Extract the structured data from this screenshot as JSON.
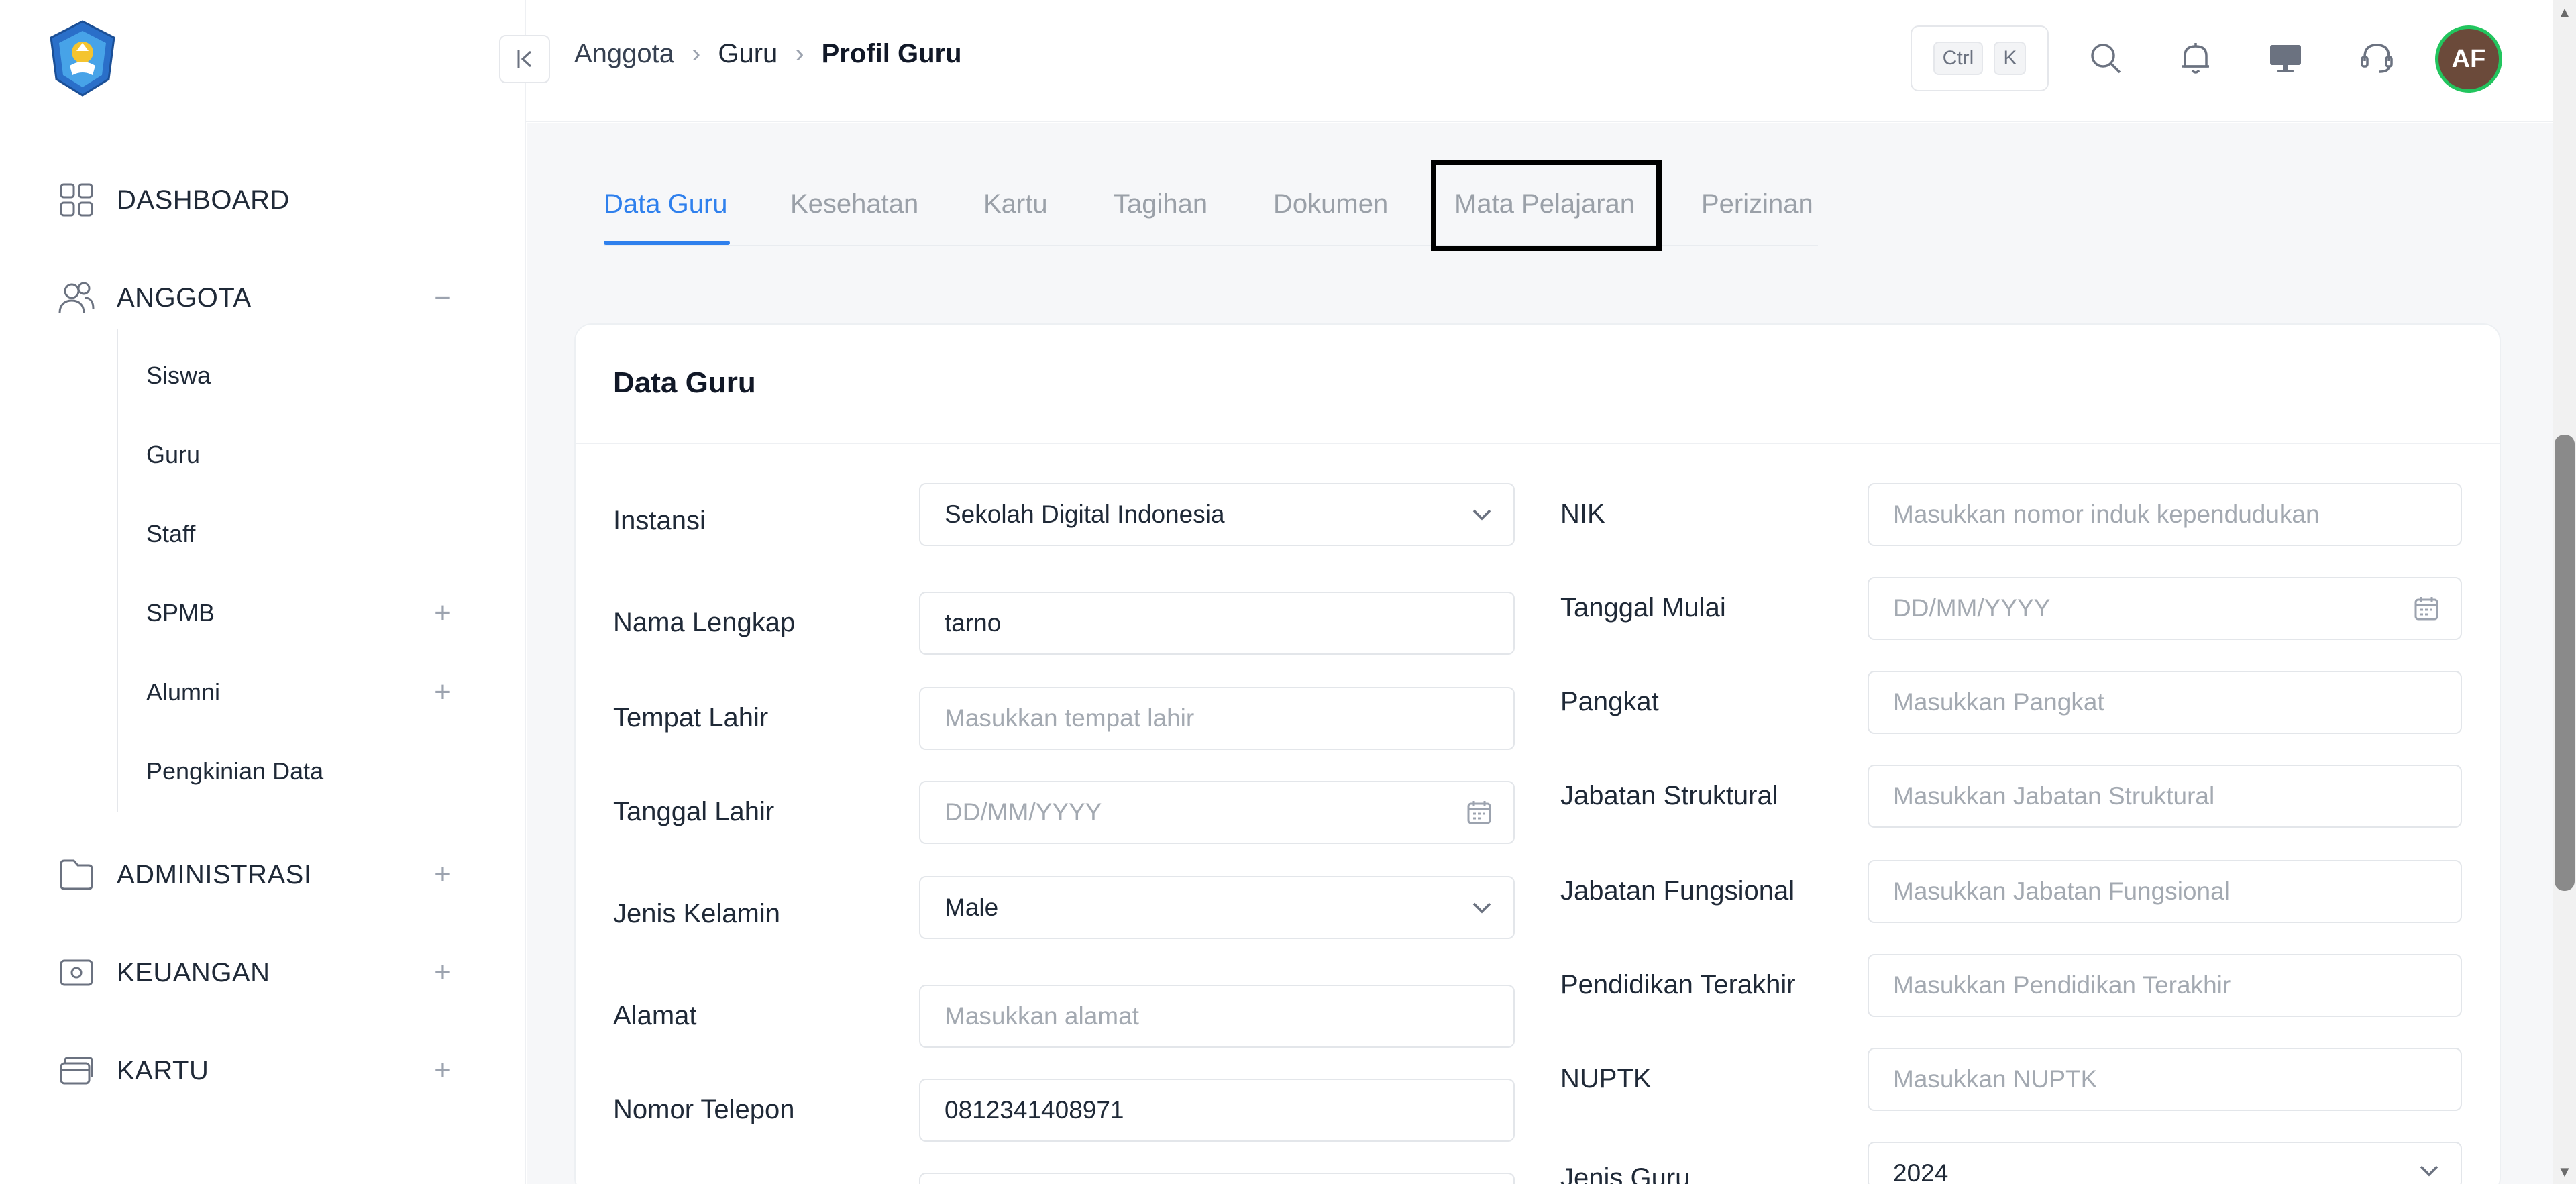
{
  "sidebar": {
    "logo_label": "Tut Wuri Handayani",
    "items": [
      {
        "label": "DASHBOARD",
        "icon": "grid-icon"
      },
      {
        "label": "ANGGOTA",
        "icon": "users-icon",
        "toggle": "−"
      },
      {
        "label": "ADMINISTRASI",
        "icon": "folder-icon",
        "toggle": "+"
      },
      {
        "label": "KEUANGAN",
        "icon": "money-icon",
        "toggle": "+"
      },
      {
        "label": "KARTU",
        "icon": "card-icon",
        "toggle": "+"
      }
    ],
    "sub_items": [
      {
        "label": "Siswa"
      },
      {
        "label": "Guru"
      },
      {
        "label": "Staff"
      },
      {
        "label": "SPMB",
        "toggle": "+"
      },
      {
        "label": "Alumni",
        "toggle": "+"
      },
      {
        "label": "Pengkinian Data"
      }
    ]
  },
  "header": {
    "breadcrumb": [
      "Anggota",
      "Guru",
      "Profil Guru"
    ],
    "shortcut": [
      "Ctrl",
      "K"
    ],
    "avatar_initials": "AF",
    "icons": [
      "search-icon",
      "bell-icon",
      "monitor-icon",
      "headset-icon"
    ]
  },
  "tabs": [
    "Data Guru",
    "Kesehatan",
    "Kartu",
    "Tagihan",
    "Dokumen",
    "Mata Pelajaran",
    "Perizinan"
  ],
  "active_tab": "Data Guru",
  "highlighted_tab": "Mata Pelajaran",
  "card": {
    "title": "Data Guru",
    "left_fields": [
      {
        "label": "Instansi",
        "value": "Sekolah Digital Indonesia",
        "placeholder": "",
        "type": "select"
      },
      {
        "label": "Nama Lengkap",
        "value": "tarno",
        "placeholder": "",
        "type": "text"
      },
      {
        "label": "Tempat Lahir",
        "value": "",
        "placeholder": "Masukkan tempat lahir",
        "type": "text"
      },
      {
        "label": "Tanggal Lahir",
        "value": "",
        "placeholder": "DD/MM/YYYY",
        "type": "date"
      },
      {
        "label": "Jenis Kelamin",
        "value": "Male",
        "placeholder": "",
        "type": "select"
      },
      {
        "label": "Alamat",
        "value": "",
        "placeholder": "Masukkan alamat",
        "type": "text"
      },
      {
        "label": "Nomor Telepon",
        "value": "0812341408971",
        "placeholder": "",
        "type": "text"
      }
    ],
    "right_fields": [
      {
        "label": "NIK",
        "value": "",
        "placeholder": "Masukkan nomor induk kependudukan",
        "type": "text"
      },
      {
        "label": "Tanggal Mulai",
        "value": "",
        "placeholder": "DD/MM/YYYY",
        "type": "date"
      },
      {
        "label": "Pangkat",
        "value": "",
        "placeholder": "Masukkan Pangkat",
        "type": "text"
      },
      {
        "label": "Jabatan Struktural",
        "value": "",
        "placeholder": "Masukkan Jabatan Struktural",
        "type": "text"
      },
      {
        "label": "Jabatan Fungsional",
        "value": "",
        "placeholder": "Masukkan Jabatan Fungsional",
        "type": "text"
      },
      {
        "label": "Pendidikan Terakhir",
        "value": "",
        "placeholder": "Masukkan Pendidikan Terakhir",
        "type": "text"
      },
      {
        "label": "NUPTK",
        "value": "",
        "placeholder": "Masukkan NUPTK",
        "type": "text"
      },
      {
        "label": "Jenis Guru",
        "value": "2024",
        "placeholder": "",
        "type": "select"
      }
    ]
  },
  "colors": {
    "accent": "#2f80ed",
    "avatar_bg": "#6b4a3a",
    "avatar_ring": "#22c55e"
  }
}
